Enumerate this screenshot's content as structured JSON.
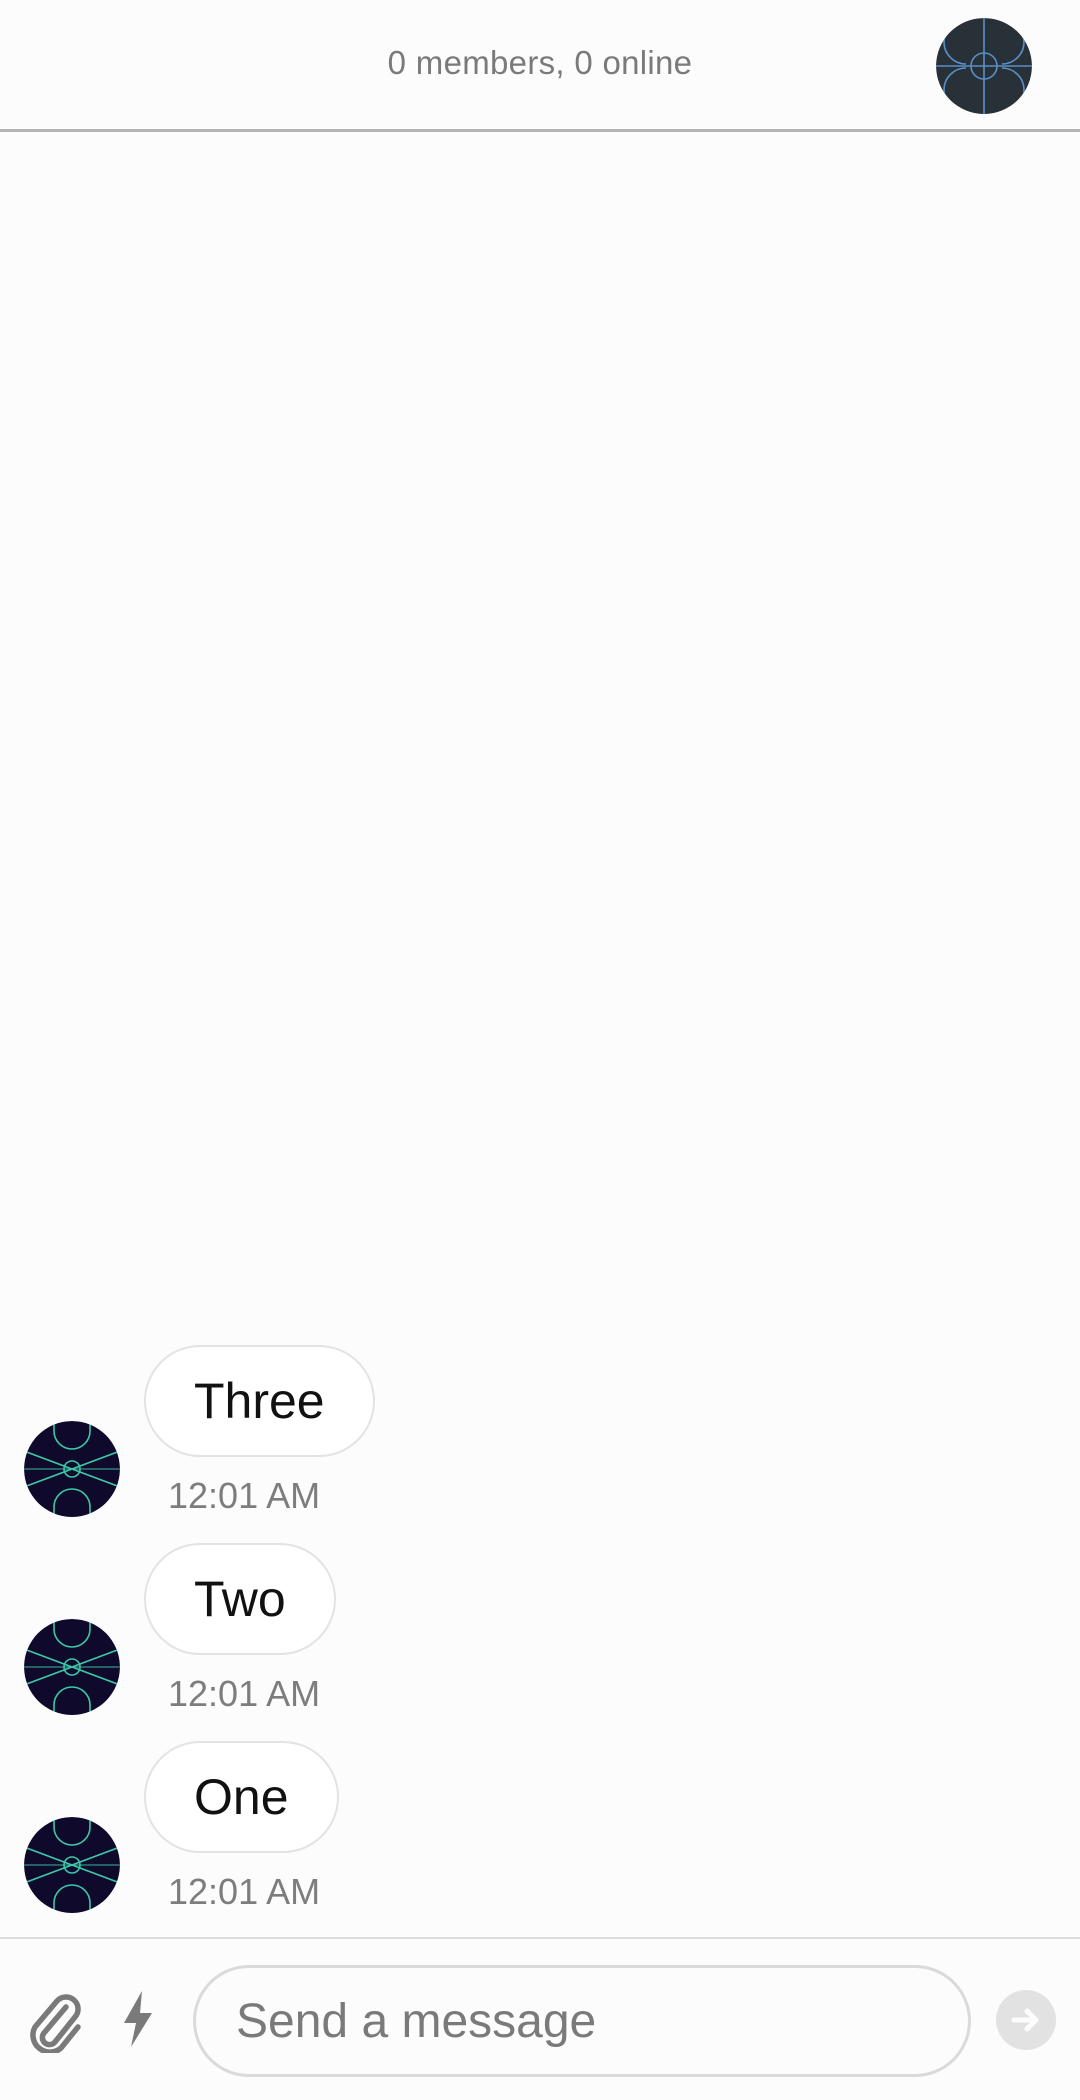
{
  "header": {
    "status": "0 members, 0 online",
    "avatar_icon": "channel-avatar-icon"
  },
  "messages": [
    {
      "text": "Three",
      "time": "12:01 AM",
      "avatar_icon": "user-avatar-icon"
    },
    {
      "text": "Two",
      "time": "12:01 AM",
      "avatar_icon": "user-avatar-icon"
    },
    {
      "text": "One",
      "time": "12:01 AM",
      "avatar_icon": "user-avatar-icon"
    }
  ],
  "composer": {
    "placeholder": "Send a message",
    "attach_icon": "paperclip-icon",
    "commands_icon": "lightning-icon",
    "send_icon": "send-arrow-icon"
  },
  "colors": {
    "background": "#fcfcfc",
    "header_avatar": "#283038",
    "header_avatar_lines": "#5a8fc8",
    "user_avatar": "#0f0a2c",
    "user_avatar_lines": "#3cc9a8",
    "bubble_border": "#e3e3e3",
    "secondary_text": "#7a7a7a"
  }
}
